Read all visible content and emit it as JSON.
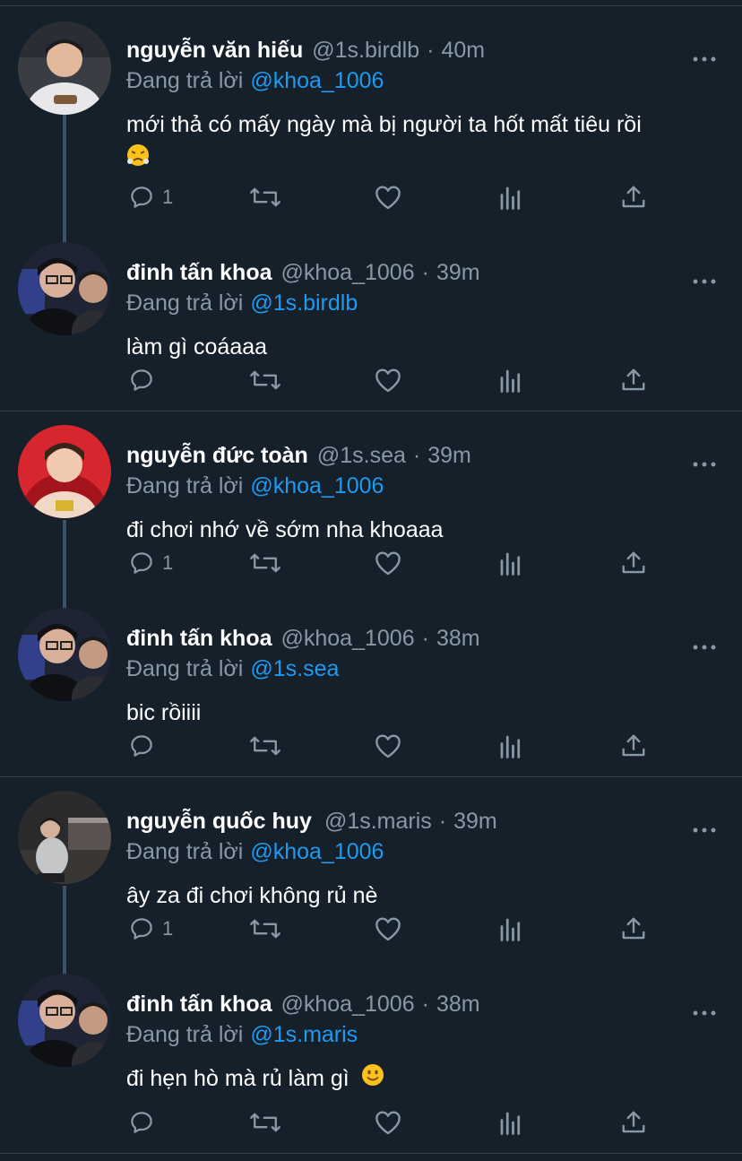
{
  "tweets": [
    {
      "name": "nguyễn văn hiếu",
      "handle": "@1s.birdlb",
      "dot": "·",
      "time": "40m",
      "replying": "Đang trả lời",
      "mention": "@khoa_1006",
      "text": "mới thả có mấy ngày mà bị người ta hốt mất tiêu rồi",
      "emoji": "huffing-face",
      "replies": "1"
    },
    {
      "name": "đinh tấn khoa",
      "handle": "@khoa_1006",
      "dot": "·",
      "time": "39m",
      "replying": "Đang trả lời",
      "mention": "@1s.birdlb",
      "text": "làm gì coáaaa",
      "replies": ""
    },
    {
      "name": "nguyễn đức toàn",
      "handle": "@1s.sea",
      "dot": "·",
      "time": "39m",
      "replying": "Đang trả lời",
      "mention": "@khoa_1006",
      "text": "đi chơi nhớ về sớm nha khoaaa",
      "replies": "1"
    },
    {
      "name": "đinh tấn khoa",
      "handle": "@khoa_1006",
      "dot": "·",
      "time": "38m",
      "replying": "Đang trả lời",
      "mention": "@1s.sea",
      "text": "bic rồiiii",
      "replies": ""
    },
    {
      "name": "nguyễn quốc huy",
      "handle": "@1s.maris",
      "dot": "·",
      "time": "39m",
      "replying": "Đang trả lời",
      "mention": "@khoa_1006",
      "text": "ây za đi chơi không rủ nè",
      "replies": "1"
    },
    {
      "name": "đinh tấn khoa",
      "handle": "@khoa_1006",
      "dot": "·",
      "time": "38m",
      "replying": "Đang trả lời",
      "mention": "@1s.maris",
      "text": "đi hẹn hò mà rủ làm gì",
      "emoji": "slightly-smiling-face",
      "replies": ""
    }
  ],
  "icons": {
    "reply": "reply-icon",
    "retweet": "retweet-icon",
    "like": "heart-icon",
    "views": "views-icon",
    "share": "share-icon",
    "more": "more-dots-icon"
  },
  "colors": {
    "background": "#15202b",
    "text": "#ffffff",
    "muted": "#8899a6",
    "link": "#1d9bf0",
    "divider": "#38444d"
  }
}
